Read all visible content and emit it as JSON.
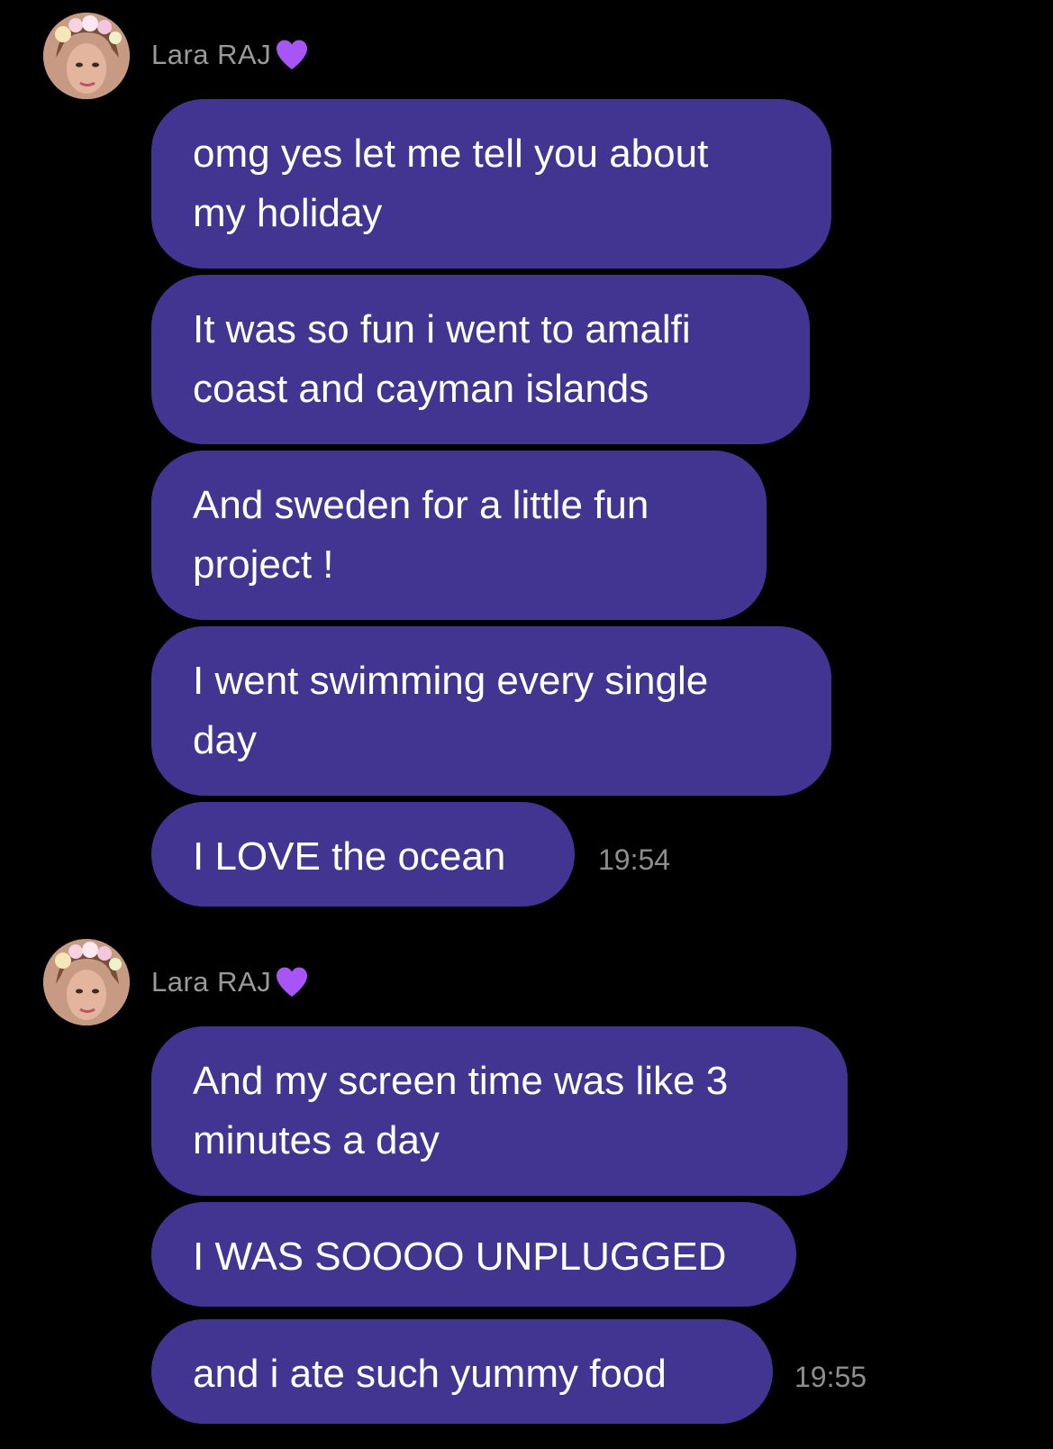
{
  "colors": {
    "background": "#000000",
    "bubble": "#423592",
    "text": "#ffffff",
    "meta_text": "#9a9a9a",
    "heart": "#a855f7"
  },
  "groups": [
    {
      "sender": {
        "name": "Lara RAJ",
        "badge_icon": "purple-heart-icon"
      },
      "messages": [
        "omg yes let me tell you about\nmy holiday",
        "It was so fun i went to amalfi\ncoast and cayman islands",
        "And sweden for a little fun\nproject !",
        "I went swimming every single\nday",
        "I LOVE the ocean"
      ],
      "time": "19:54"
    },
    {
      "sender": {
        "name": "Lara RAJ",
        "badge_icon": "purple-heart-icon"
      },
      "messages": [
        "And my screen time was like 3\nminutes a day",
        "I WAS SOOOO UNPLUGGED",
        "and i ate such yummy food"
      ],
      "time": "19:55"
    }
  ]
}
